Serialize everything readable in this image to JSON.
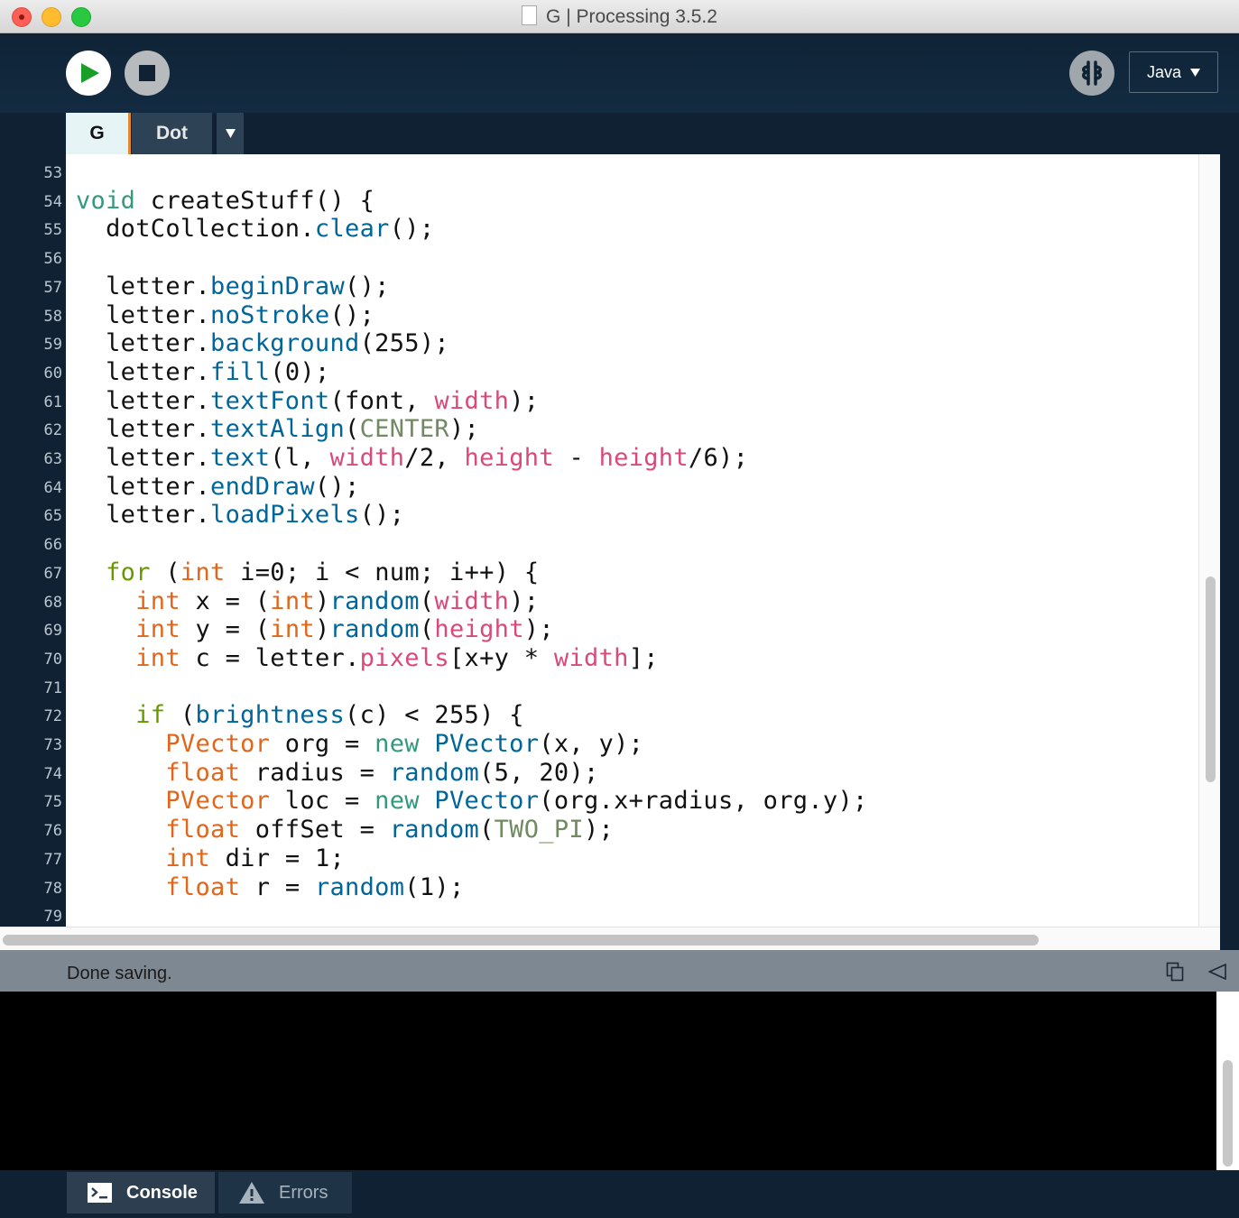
{
  "window": {
    "title": "G | Processing 3.5.2"
  },
  "toolbar": {
    "mode_label": "Java"
  },
  "tabs": [
    {
      "label": "G"
    },
    {
      "label": "Dot"
    }
  ],
  "editor": {
    "lines": [
      {
        "n": "53",
        "code": ""
      },
      {
        "n": "54",
        "code": "void createStuff() {"
      },
      {
        "n": "55",
        "code": "  dotCollection.clear();"
      },
      {
        "n": "56",
        "code": ""
      },
      {
        "n": "57",
        "code": "  letter.beginDraw();"
      },
      {
        "n": "58",
        "code": "  letter.noStroke();"
      },
      {
        "n": "59",
        "code": "  letter.background(255);"
      },
      {
        "n": "60",
        "code": "  letter.fill(0);"
      },
      {
        "n": "61",
        "code": "  letter.textFont(font, width);"
      },
      {
        "n": "62",
        "code": "  letter.textAlign(CENTER);"
      },
      {
        "n": "63",
        "code": "  letter.text(l, width/2, height - height/6);"
      },
      {
        "n": "64",
        "code": "  letter.endDraw();"
      },
      {
        "n": "65",
        "code": "  letter.loadPixels();"
      },
      {
        "n": "66",
        "code": ""
      },
      {
        "n": "67",
        "code": "  for (int i=0; i < num; i++) {"
      },
      {
        "n": "68",
        "code": "    int x = (int)random(width);"
      },
      {
        "n": "69",
        "code": "    int y = (int)random(height);"
      },
      {
        "n": "70",
        "code": "    int c = letter.pixels[x+y * width];"
      },
      {
        "n": "71",
        "code": ""
      },
      {
        "n": "72",
        "code": "    if (brightness(c) < 255) {"
      },
      {
        "n": "73",
        "code": "      PVector org = new PVector(x, y);"
      },
      {
        "n": "74",
        "code": "      float radius = random(5, 20);"
      },
      {
        "n": "75",
        "code": "      PVector loc = new PVector(org.x+radius, org.y);"
      },
      {
        "n": "76",
        "code": "      float offSet = random(TWO_PI);"
      },
      {
        "n": "77",
        "code": "      int dir = 1;"
      },
      {
        "n": "78",
        "code": "      float r = random(1);"
      },
      {
        "n": "79",
        "code": ""
      }
    ]
  },
  "status": {
    "message": "Done saving."
  },
  "bottom_tabs": {
    "console_label": "Console",
    "errors_label": "Errors"
  },
  "icons": {
    "run": "play-icon",
    "stop": "stop-icon",
    "mode": "debugger-icon",
    "copy": "copy-icon",
    "collapse": "collapse-triangle-icon",
    "console": "terminal-icon",
    "errors": "warning-icon"
  },
  "colors": {
    "keyword": "#e2661a",
    "void": "#33997e",
    "control": "#669900",
    "function": "#006699",
    "builtin_var": "#d94a7a",
    "constant": "#718a62",
    "accent_tab": "#e08a2a"
  }
}
